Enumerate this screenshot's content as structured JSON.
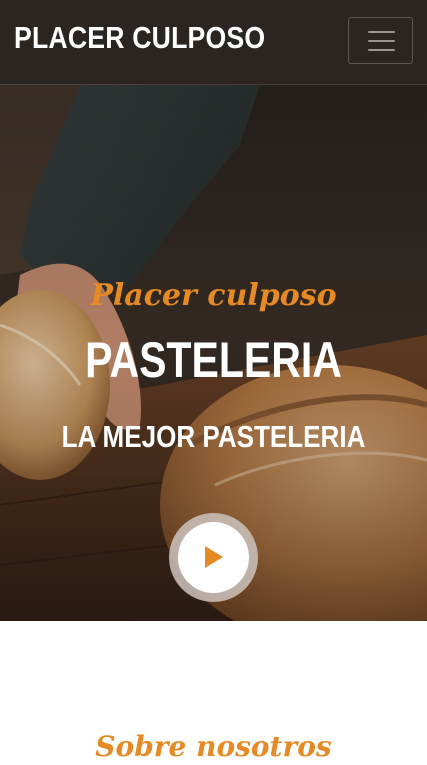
{
  "navbar": {
    "brand": "PLACER CULPOSO",
    "menu_icon": "hamburger-menu-icon"
  },
  "hero": {
    "script_title": "Placer culposo",
    "title": "PASTELERIA",
    "subtitle": "LA MEJOR PASTELERIA",
    "play_icon": "play-icon",
    "background_image": "hand-holding-bread-loaf"
  },
  "about": {
    "title": "Sobre nosotros"
  },
  "colors": {
    "accent": "#e58a24",
    "navbar_bg": "#2b2522",
    "text_light": "#ffffff"
  }
}
